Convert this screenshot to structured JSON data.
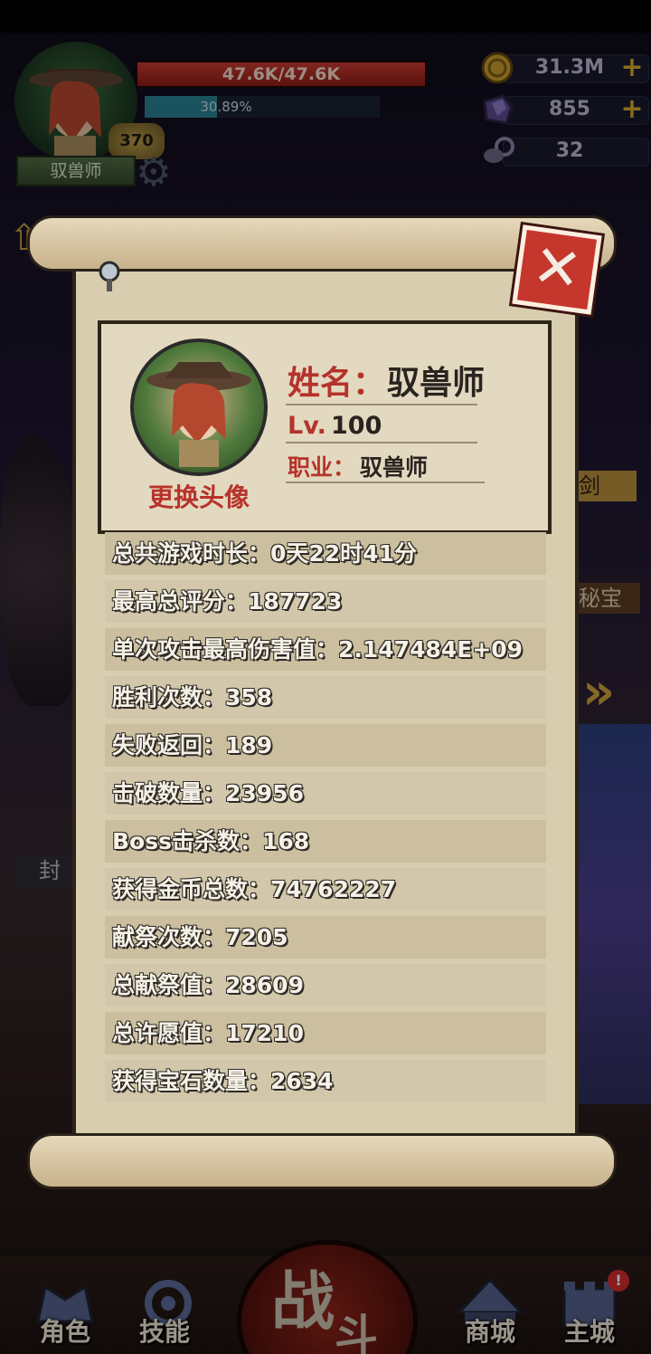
{
  "hud": {
    "hp_text": "47.6K/47.6K",
    "hp_fraction": 1.0,
    "xp_text": "30.89%",
    "xp_fraction": 0.3089,
    "level": "370",
    "class_name": "驭兽师",
    "gold": "31.3M",
    "crystal": "855",
    "ram_skull": "32"
  },
  "profile": {
    "name_label": "姓名：",
    "name_value": "驭兽师",
    "lv_label": "Lv.",
    "lv_value": "100",
    "job_label": "职业：",
    "job_value": "驭兽师",
    "change_avatar": "更换头像"
  },
  "stats": [
    {
      "label": "总共游戏时长：0天22时41分"
    },
    {
      "label": "最高总评分：187723"
    },
    {
      "label": "单次攻击最高伤害值：2.147484E+09"
    },
    {
      "label": "胜利次数：358"
    },
    {
      "label": "失败返回：189"
    },
    {
      "label": "击破数量：23956"
    },
    {
      "label": "Boss击杀数：168"
    },
    {
      "label": "获得金币总数：74762227"
    },
    {
      "label": "献祭次数：7205"
    },
    {
      "label": "总献祭值：28609"
    },
    {
      "label": "总许愿值：17210"
    },
    {
      "label": "获得宝石数量：2634"
    }
  ],
  "bottom_nav": {
    "role": "角色",
    "skill": "技能",
    "battle_1": "战",
    "battle_2": "斗",
    "shop": "商城",
    "city": "主城",
    "city_badge": "!"
  },
  "side_partial": {
    "left_label": "封",
    "right_label_1": "剑",
    "right_label_2": "秘宝"
  },
  "colors": {
    "accent_red": "#b5332b",
    "paper": "#d9cdb0",
    "gold": "#d4a52a"
  }
}
